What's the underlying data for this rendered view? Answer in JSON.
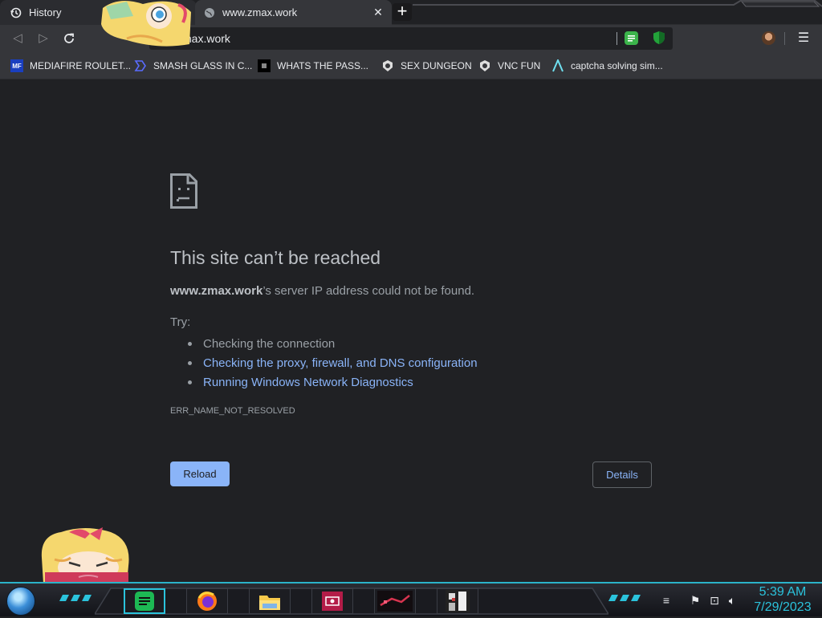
{
  "tabs": [
    {
      "label": "History",
      "icon": "history-icon"
    },
    {
      "label": "www.zmax.work",
      "icon": "globe-icon"
    }
  ],
  "toolbar": {
    "url": "zmax.work",
    "extensions": [
      "chat-extension-icon",
      "shield-extension-icon"
    ]
  },
  "bookmarks": [
    {
      "label": "MEDIAFIRE ROULET...",
      "icon": "mediafire-icon",
      "icon_text": "MF"
    },
    {
      "label": "SMASH GLASS IN C...",
      "icon": "bracket-icon"
    },
    {
      "label": "WHATS THE PASS...",
      "icon": "dark-square-icon"
    },
    {
      "label": "SEX DUNGEON",
      "icon": "bookmark-gear-icon"
    },
    {
      "label": "VNC FUN",
      "icon": "bookmark-gear-icon"
    },
    {
      "label": "captcha solving sim...",
      "icon": "arrow-a-icon"
    }
  ],
  "error": {
    "title": "This site can’t be reached",
    "host": "www.zmax.work",
    "desc_suffix": "’s server IP address could not be found.",
    "try_label": "Try:",
    "suggestions": [
      "Checking the connection",
      "Checking the proxy, firewall, and DNS configuration",
      "Running Windows Network Diagnostics"
    ],
    "code": "ERR_NAME_NOT_RESOLVED",
    "reload_label": "Reload",
    "details_label": "Details"
  },
  "taskbar": {
    "apps": [
      "spotify-icon",
      "firefox-icon",
      "file-explorer-icon",
      "media-app-icon",
      "game-app-icon",
      "pixel-app-icon"
    ],
    "time": "5:39 AM",
    "date": "7/29/2023"
  },
  "colors": {
    "accent": "#8ab4f8",
    "taskbar_accent": "#2bc3dc",
    "page_bg": "#202124"
  }
}
